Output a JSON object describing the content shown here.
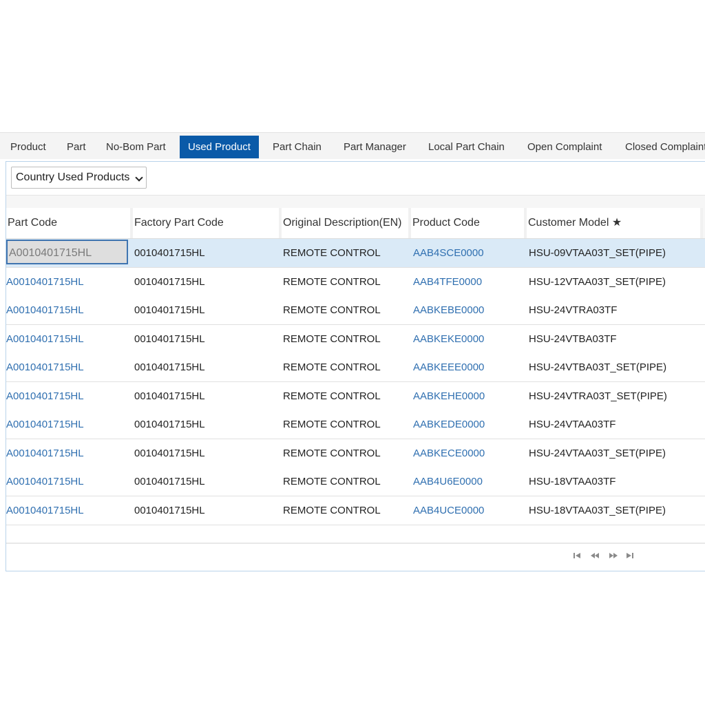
{
  "tabs": [
    {
      "label": "Product"
    },
    {
      "label": "Part"
    },
    {
      "label": "No-Bom Part"
    },
    {
      "label": "Used Product",
      "active": true
    },
    {
      "label": "Part Chain"
    },
    {
      "label": "Part Manager"
    },
    {
      "label": "Local Part Chain"
    },
    {
      "label": "Open Complaint"
    },
    {
      "label": "Closed Complaint"
    }
  ],
  "filter": {
    "selected": "Country Used Products"
  },
  "grid": {
    "columns": [
      "Part Code",
      "Factory Part Code",
      "Original Description(EN)",
      "Product Code",
      "Customer Model ★"
    ],
    "rows": [
      {
        "part_code": "A0010401715HL",
        "factory_code": "0010401715HL",
        "description": "REMOTE CONTROL",
        "product_code": "AAB4SCE0000",
        "customer_model": "HSU-09VTAA03T_SET(PIPE)"
      },
      {
        "part_code": "A0010401715HL",
        "factory_code": "0010401715HL",
        "description": "REMOTE CONTROL",
        "product_code": "AAB4TFE0000",
        "customer_model": "HSU-12VTAA03T_SET(PIPE)"
      },
      {
        "part_code": "A0010401715HL",
        "factory_code": "0010401715HL",
        "description": "REMOTE CONTROL",
        "product_code": "AABKEBE0000",
        "customer_model": "HSU-24VTRA03TF"
      },
      {
        "part_code": "A0010401715HL",
        "factory_code": "0010401715HL",
        "description": "REMOTE CONTROL",
        "product_code": "AABKEKE0000",
        "customer_model": "HSU-24VTBA03TF"
      },
      {
        "part_code": "A0010401715HL",
        "factory_code": "0010401715HL",
        "description": "REMOTE CONTROL",
        "product_code": "AABKEEE0000",
        "customer_model": "HSU-24VTBA03T_SET(PIPE)"
      },
      {
        "part_code": "A0010401715HL",
        "factory_code": "0010401715HL",
        "description": "REMOTE CONTROL",
        "product_code": "AABKEHE0000",
        "customer_model": "HSU-24VTRA03T_SET(PIPE)"
      },
      {
        "part_code": "A0010401715HL",
        "factory_code": "0010401715HL",
        "description": "REMOTE CONTROL",
        "product_code": "AABKEDE0000",
        "customer_model": "HSU-24VTAA03TF"
      },
      {
        "part_code": "A0010401715HL",
        "factory_code": "0010401715HL",
        "description": "REMOTE CONTROL",
        "product_code": "AABKECE0000",
        "customer_model": "HSU-24VTAA03T_SET(PIPE)"
      },
      {
        "part_code": "A0010401715HL",
        "factory_code": "0010401715HL",
        "description": "REMOTE CONTROL",
        "product_code": "AAB4U6E0000",
        "customer_model": "HSU-18VTAA03TF"
      },
      {
        "part_code": "A0010401715HL",
        "factory_code": "0010401715HL",
        "description": "REMOTE CONTROL",
        "product_code": "AAB4UCE0000",
        "customer_model": "HSU-18VTAA03T_SET(PIPE)"
      }
    ]
  },
  "pager": {
    "icons": [
      "first-page-icon",
      "prev-page-icon",
      "next-page-icon",
      "last-page-icon"
    ]
  },
  "colors": {
    "accent": "#0a5aa8",
    "link": "#2f6fb0",
    "selected_row": "#daeaf7"
  }
}
